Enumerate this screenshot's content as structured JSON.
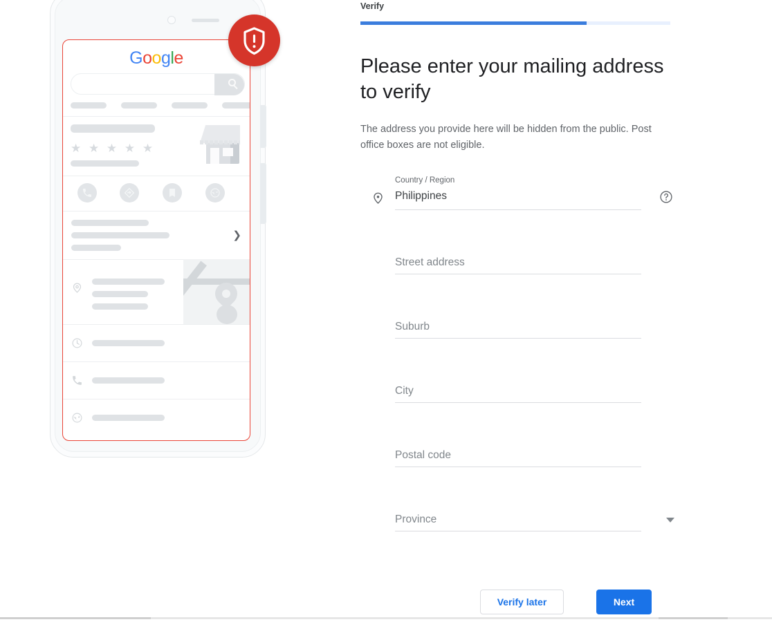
{
  "step": {
    "label": "Verify",
    "progress_percent": 73,
    "progress_fill_color": "#3b7ddd",
    "progress_track_color": "#e8f0fe"
  },
  "headline": "Please enter your mailing address to verify",
  "subtext": "The address you provide here will be hidden from the public. Post office boxes are not eligible.",
  "form": {
    "country": {
      "label": "Country / Region",
      "value": "Philippines",
      "pin_icon": "location-pin-icon",
      "help_icon": "help-circle-icon"
    },
    "street": {
      "placeholder": "Street address",
      "value": ""
    },
    "suburb": {
      "placeholder": "Suburb",
      "value": ""
    },
    "city": {
      "placeholder": "City",
      "value": ""
    },
    "postal": {
      "placeholder": "Postal code",
      "value": ""
    },
    "province": {
      "placeholder": "Province",
      "value": "",
      "caret_icon": "chevron-down-icon"
    }
  },
  "buttons": {
    "secondary": "Verify later",
    "primary": "Next",
    "primary_color": "#1a73e8",
    "secondary_text_color": "#1a73e8"
  },
  "illustration": {
    "brand": "Google",
    "brand_letters": [
      {
        "char": "G",
        "color": "#4285F4"
      },
      {
        "char": "o",
        "color": "#EA4335"
      },
      {
        "char": "o",
        "color": "#FBBC05"
      },
      {
        "char": "g",
        "color": "#4285F4"
      },
      {
        "char": "l",
        "color": "#34A853"
      },
      {
        "char": "e",
        "color": "#EA4335"
      }
    ],
    "screen_outline_color": "#ea4335",
    "badge": {
      "icon": "shield-alert-icon",
      "color": "#d5352a"
    },
    "search_icon": "search-icon",
    "rating_stars": "★ ★ ★ ★ ★",
    "action_icons": [
      "phone-icon",
      "directions-icon",
      "bookmark-icon",
      "globe-icon"
    ],
    "detail_rows": [
      "clock-icon",
      "phone-icon",
      "globe-icon"
    ],
    "chevron_icon": "chevron-right-icon",
    "map_pin_icon": "map-pin-icon",
    "storefront_icon": "storefront-icon"
  }
}
